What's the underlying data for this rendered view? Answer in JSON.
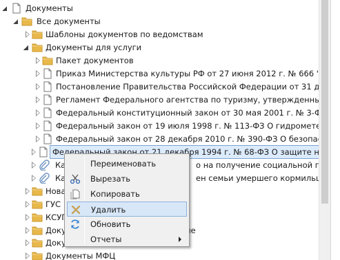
{
  "tree": {
    "rows": [
      {
        "label": "Документы",
        "icon": "document-icon",
        "toggle": "expanded"
      },
      {
        "label": "Все документы",
        "icon": "folder-icon",
        "toggle": "expanded"
      },
      {
        "label": "Шаблоны документов по ведомствам",
        "icon": "folder-icon",
        "toggle": "collapsed"
      },
      {
        "label": "Документы для услуги",
        "icon": "folder-icon",
        "toggle": "expanded"
      },
      {
        "label": "Пакет документов",
        "icon": "folder-icon",
        "toggle": "collapsed"
      },
      {
        "label": "Приказ Министерства культуры РФ от 27 июня 2012 г. № 666 \"Об утв",
        "icon": "document-icon",
        "toggle": "collapsed"
      },
      {
        "label": "Постановление Правительства Российской Федерации от 31 декабря",
        "icon": "document-icon",
        "toggle": "collapsed"
      },
      {
        "label": "Регламент Федерального агентства по туризму, утвержденный прика",
        "icon": "document-icon",
        "toggle": "collapsed"
      },
      {
        "label": "Федеральный конституционный закон от 30 мая 2001 г. № 3-ФКЗ О ч",
        "icon": "document-icon",
        "toggle": "collapsed"
      },
      {
        "label": "Федеральный закон от 19 июля 1998 г. № 113-ФЗ О гидрометеороло",
        "icon": "document-icon",
        "toggle": "collapsed"
      },
      {
        "label": "Федеральный закон от 28 декабря 2010 г. № 390-ФЗ О безопасности",
        "icon": "document-icon",
        "toggle": "collapsed"
      },
      {
        "label": "Федеральный закон от 21 декабря 1994 г. № 68-ФЗ О защите населен",
        "icon": "document-icon",
        "toggle": "collapsed",
        "selected": true
      },
      {
        "label_left": "Ка",
        "label_right": "о на получение социальной пенси",
        "icon": "attachment-icon",
        "toggle": "collapsed"
      },
      {
        "label_left": "Ка",
        "label_right": "ен семьи умершего кормильца\"",
        "icon": "attachment-icon",
        "toggle": "collapsed"
      },
      {
        "label_left": "Нова",
        "label_right": "",
        "icon": "folder-icon",
        "toggle": "collapsed"
      },
      {
        "label_left": "ГУС 1",
        "label_right": "",
        "icon": "folder-icon",
        "toggle": "collapsed"
      },
      {
        "label_left": "КСУГ",
        "label_right": "",
        "icon": "folder-icon",
        "toggle": "collapsed"
      },
      {
        "label_left": "Доку",
        "label_right": "ме",
        "icon": "folder-icon",
        "toggle": "collapsed"
      },
      {
        "label_left": "Доку",
        "label_right": "",
        "icon": "folder-icon",
        "toggle": "collapsed"
      },
      {
        "label_left": "Доку",
        "label_right": "",
        "icon": "folder-icon",
        "toggle": "collapsed"
      },
      {
        "label": "Документы МФЦ",
        "icon": "folder-icon",
        "toggle": "collapsed"
      }
    ]
  },
  "context_menu": {
    "items": [
      {
        "label": "Переименовать",
        "icon": ""
      },
      {
        "label": "Вырезать",
        "icon": "scissors-icon"
      },
      {
        "label": "Копировать",
        "icon": "copy-icon"
      },
      {
        "label": "Удалить",
        "icon": "delete-icon",
        "highlighted": true
      },
      {
        "label": "Обновить",
        "icon": "refresh-icon"
      },
      {
        "label": "Отчеты",
        "icon": "",
        "submenu": true
      }
    ]
  },
  "colors": {
    "folder": "#e8b94a",
    "selection_fill": "#dcebfc",
    "selection_border": "#7da2ce",
    "menu_background": "#f0f0f0",
    "menu_highlight": "#d7e7f8"
  }
}
